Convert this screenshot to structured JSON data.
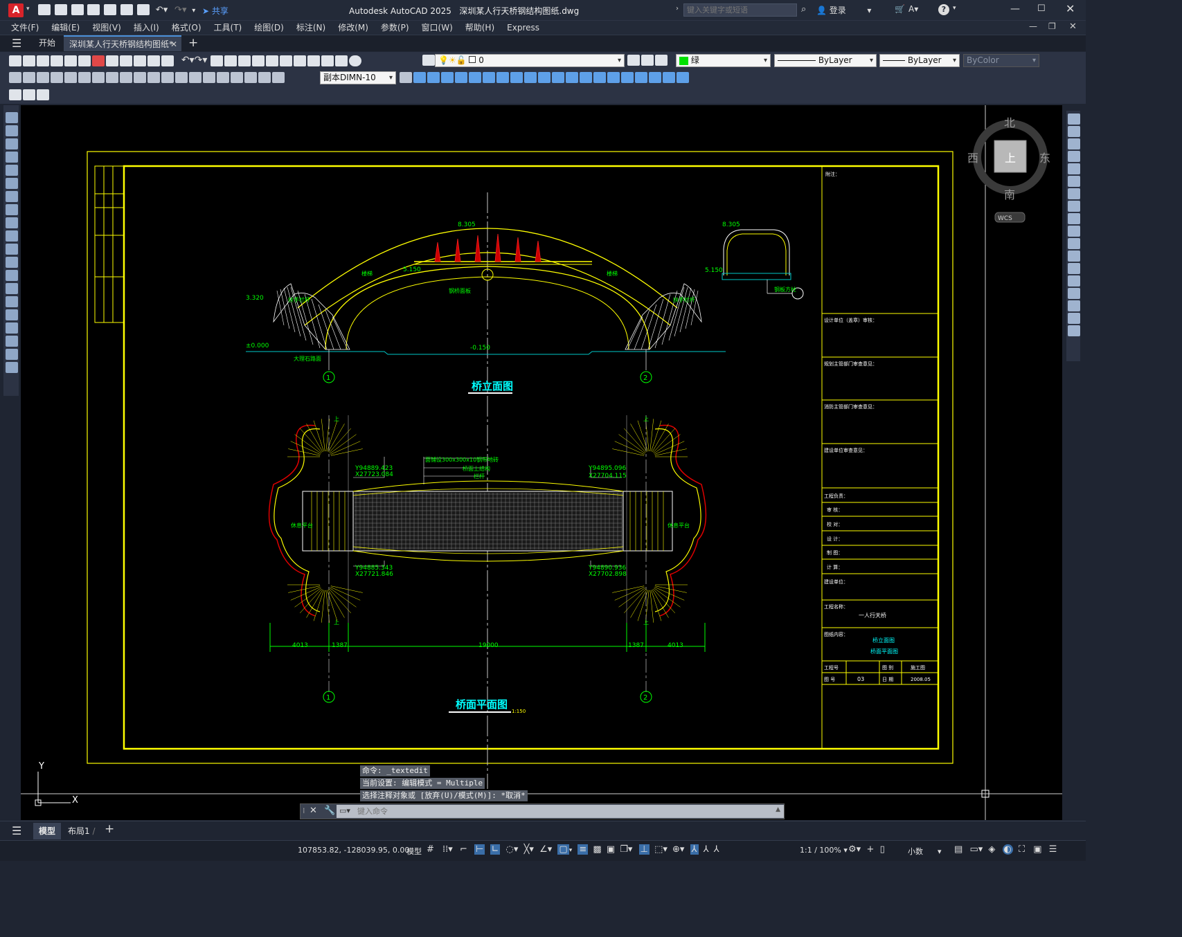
{
  "app": {
    "title": "Autodesk AutoCAD 2025",
    "filename": "深圳某人行天桥钢结构图纸.dwg",
    "search_placeholder": "键入关键字或短语",
    "login": "登录",
    "share": "共享"
  },
  "menu": [
    "文件(F)",
    "编辑(E)",
    "视图(V)",
    "插入(I)",
    "格式(O)",
    "工具(T)",
    "绘图(D)",
    "标注(N)",
    "修改(M)",
    "参数(P)",
    "窗口(W)",
    "帮助(H)",
    "Express"
  ],
  "tabs": {
    "start": "开始",
    "doc": "深圳某人行天桥钢结构图纸*"
  },
  "properties": {
    "layer": "0",
    "color": "绿",
    "color_hex": "#00e000",
    "linetype": "ByLayer",
    "lineweight": "ByLayer",
    "plotstyle": "ByColor",
    "dimstyle": "副本DIMN-10"
  },
  "viewcube": {
    "north": "北",
    "south": "南",
    "east": "东",
    "west": "西",
    "top": "上",
    "wcs": "WCS"
  },
  "ucs": {
    "x": "X",
    "y": "Y"
  },
  "drawing": {
    "elev_title": "桥立面图",
    "plan_title": "桥面平面图",
    "plan_scale": "1:150",
    "elev_8305": "8.305",
    "elev_5150": "5.150",
    "elev_3320": "3.320",
    "elev_0000": "±0.000",
    "elev_m0150": "-0.150",
    "elev_side_8305": "8.305",
    "elev_side_5150": "5.150",
    "axis_1": "1",
    "axis_2": "2",
    "dim_4013": "4013",
    "dim_1387": "1387",
    "dim_19000": "19000",
    "coord_tl_y": "Y94889.423",
    "coord_tl_x": "X27723.084",
    "coord_tr_y": "Y94895.096",
    "coord_tr_x": "X27704.115",
    "coord_bl_y": "Y94885.343",
    "coord_bl_x": "X27721.846",
    "coord_br_y": "Y94890.936",
    "coord_br_x": "X27702.898",
    "note_deck": "面铺设300x300x10钢带地砖",
    "note_deck2": "桥面上结构",
    "note_deck3": "栏杆",
    "up": "上",
    "rest_left": "休息平台",
    "rest_right": "休息平台",
    "ground": "大理石路面",
    "label_stair": "楼梯",
    "label_stair2": "楼梯",
    "label_handrail": "扶手栏杆",
    "label_handrail2": "扶手栏杆",
    "label_beam": "钢桥面板",
    "label_side": "钢板方柱"
  },
  "titleblock": {
    "notes": "附注：",
    "r1": "设计单位（盖章）审核：",
    "r2": "规划主管部门审查意见：",
    "r3": "消防主管部门审查意见：",
    "r4": "建设单位审查意见：",
    "engineer": "工程负责：",
    "review": "审  核：",
    "check": "校  对：",
    "design": "设  计：",
    "draw": "制  图：",
    "calc": "计  算：",
    "client": "建设单位：",
    "proj_label": "工程名称：",
    "proj_name": "一人行天桥",
    "content_label": "图纸内容：",
    "content1": "桥立面图",
    "content2": "桥面平面图",
    "gch": "工程号",
    "tubie": "图  别",
    "tubie_val": "施工图",
    "tuhao": "图  号",
    "tuhao_val": "03",
    "date_label": "日  期",
    "date_val": "2008.05"
  },
  "command": {
    "line1": "命令: _textedit",
    "line2": "当前设置: 编辑模式 = Multiple",
    "line3": "选择注释对象或 [放弃(U)/模式(M)]: *取消*",
    "placeholder": "键入命令"
  },
  "layouts": {
    "model": "模型",
    "layout1": "布局1"
  },
  "status": {
    "coords": "107853.82, -128039.95, 0.00",
    "model": "模型",
    "scale": "1:1 / 100%",
    "units": "小数"
  }
}
